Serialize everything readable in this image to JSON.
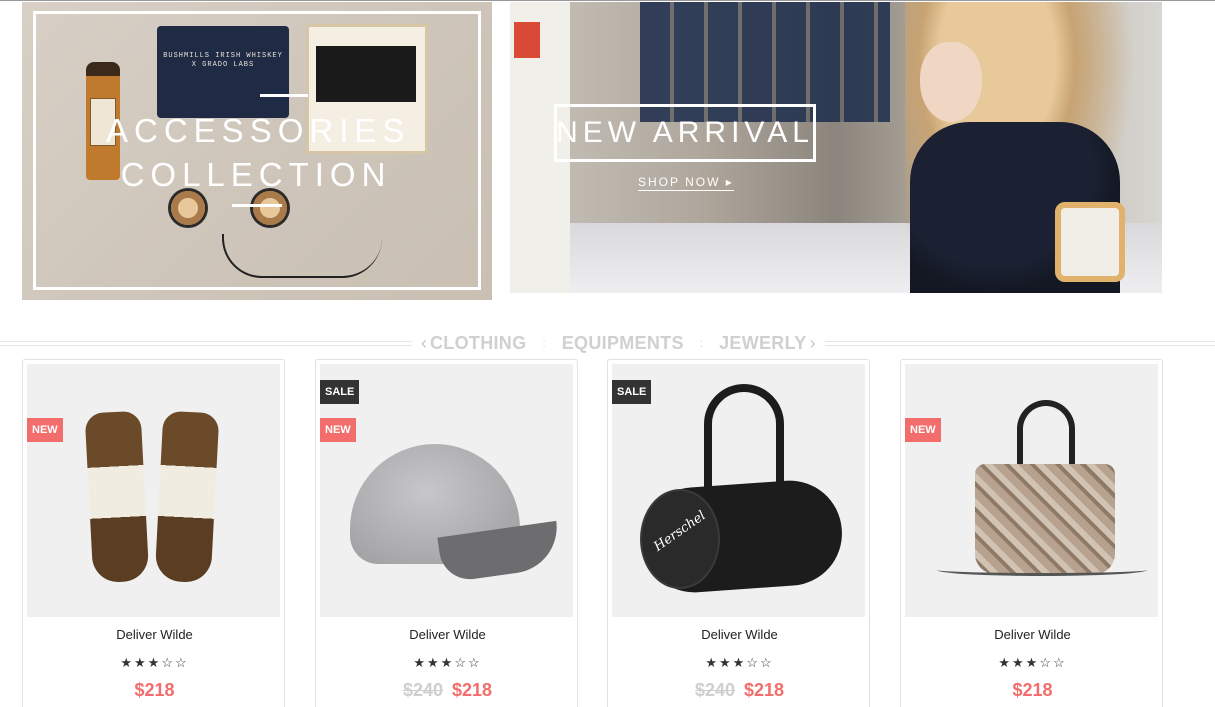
{
  "banners": {
    "accessories": {
      "line1": "ACCESSORIES",
      "line2": "COLLECTION",
      "pouch_text": "BUSHMILLS IRISH WHISKEY X GRADO LABS"
    },
    "new_arrival": {
      "title": "NEW ARRIVAL",
      "cta": "SHOP NOW ▸"
    }
  },
  "category_tabs": {
    "prev_arrow": "‹",
    "next_arrow": "›",
    "separator": ":",
    "items": [
      "CLOTHING",
      "EQUIPMENTS",
      "JEWERLY"
    ]
  },
  "products": [
    {
      "name": "Deliver Wilde",
      "badges": [
        "NEW"
      ],
      "rating_stars": "★★★☆☆",
      "rating": 3,
      "old_price": "",
      "price": "$218",
      "image_icon": "mittens-icon"
    },
    {
      "name": "Deliver Wilde",
      "badges": [
        "SALE",
        "NEW"
      ],
      "rating_stars": "★★★☆☆",
      "rating": 3,
      "old_price": "$240",
      "price": "$218",
      "image_icon": "cap-icon"
    },
    {
      "name": "Deliver Wilde",
      "badges": [
        "SALE"
      ],
      "rating_stars": "★★★☆☆",
      "rating": 3,
      "old_price": "$240",
      "price": "$218",
      "image_icon": "duffel-bag-icon",
      "image_logo_text": "Herschel"
    },
    {
      "name": "Deliver Wilde",
      "badges": [
        "NEW"
      ],
      "rating_stars": "★★★☆☆",
      "rating": 3,
      "old_price": "",
      "price": "$218",
      "image_icon": "handbag-icon"
    }
  ],
  "colors": {
    "accent_sale_price": "#f26d6b",
    "badge_new": "#f26d6b",
    "badge_sale": "#333333",
    "old_price": "#cfcfcf",
    "tab_text": "#d0d0d0"
  }
}
